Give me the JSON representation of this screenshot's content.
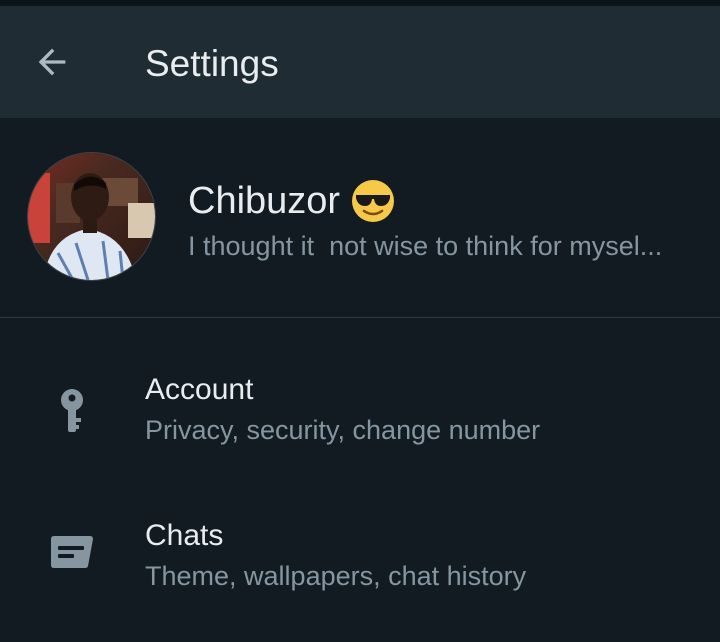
{
  "header": {
    "title": "Settings",
    "back_icon": "arrow-left-icon"
  },
  "profile": {
    "name": "Chibuzor",
    "emoji": "😎",
    "about": "I thought it  not wise to think for mysel..."
  },
  "settings": [
    {
      "title": "Account",
      "subtitle": "Privacy, security, change number",
      "icon": "key-icon"
    },
    {
      "title": "Chats",
      "subtitle": "Theme, wallpapers, chat history",
      "icon": "chat-icon"
    }
  ],
  "colors": {
    "background": "#121b22",
    "appbar": "#1f2c34",
    "primary_text": "#e9edef",
    "secondary_text": "#8696a0",
    "icon": "#8696a0"
  }
}
